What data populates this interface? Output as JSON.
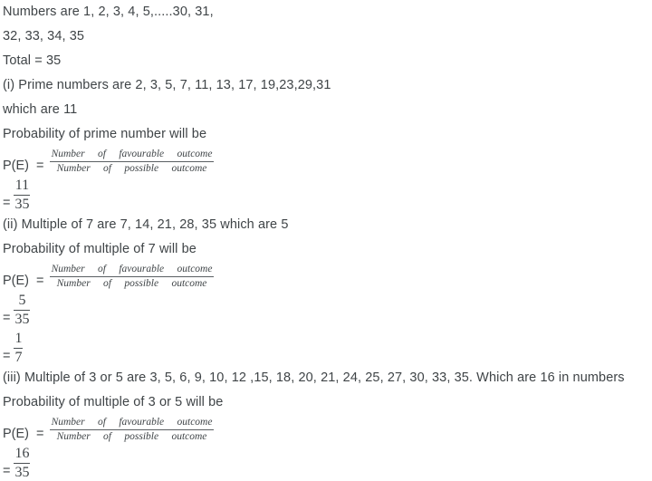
{
  "document": {
    "type": "math-solution",
    "topic": "Probability",
    "text_color": "#3f4447",
    "background_color": "#ffffff",
    "lines": {
      "numbers_line_1": "Numbers are 1, 2, 3, 4, 5,.....30, 31,",
      "numbers_line_2": "32, 33, 34, 35",
      "total": "Total = 35",
      "part_i_statement": "(i) Prime numbers are 2, 3, 5, 7, 11, 13, 17, 19,23,29,31",
      "part_i_count": "which are 11",
      "part_i_prob_label": "Probability of prime number will be",
      "part_ii_statement": "(ii) Multiple of 7 are 7, 14, 21, 28, 35 which are 5",
      "part_ii_prob_label": "Probability of multiple of 7 will be",
      "part_iii_statement": "(iii) Multiple of 3 or 5 are 3, 5, 6, 9, 10, 12 ,15, 18, 20, 21, 24, 25, 27, 30, 33, 35. Which are 16 in numbers",
      "part_iii_prob_label": "Probability of multiple of 3 or 5 will be"
    },
    "formula": {
      "pe_label": "P(E)  = ",
      "numerator": "Number     of     favourable     outcome",
      "denominator": "Number     of     possible     outcome"
    },
    "equals_sign": "=",
    "answers": {
      "part_i": {
        "numerator": "11",
        "denominator": "35"
      },
      "part_ii_unreduced": {
        "numerator": "5",
        "denominator": "35"
      },
      "part_ii_reduced": {
        "numerator": "1",
        "denominator": "7"
      },
      "part_iii": {
        "numerator": "16",
        "denominator": "35"
      }
    }
  }
}
